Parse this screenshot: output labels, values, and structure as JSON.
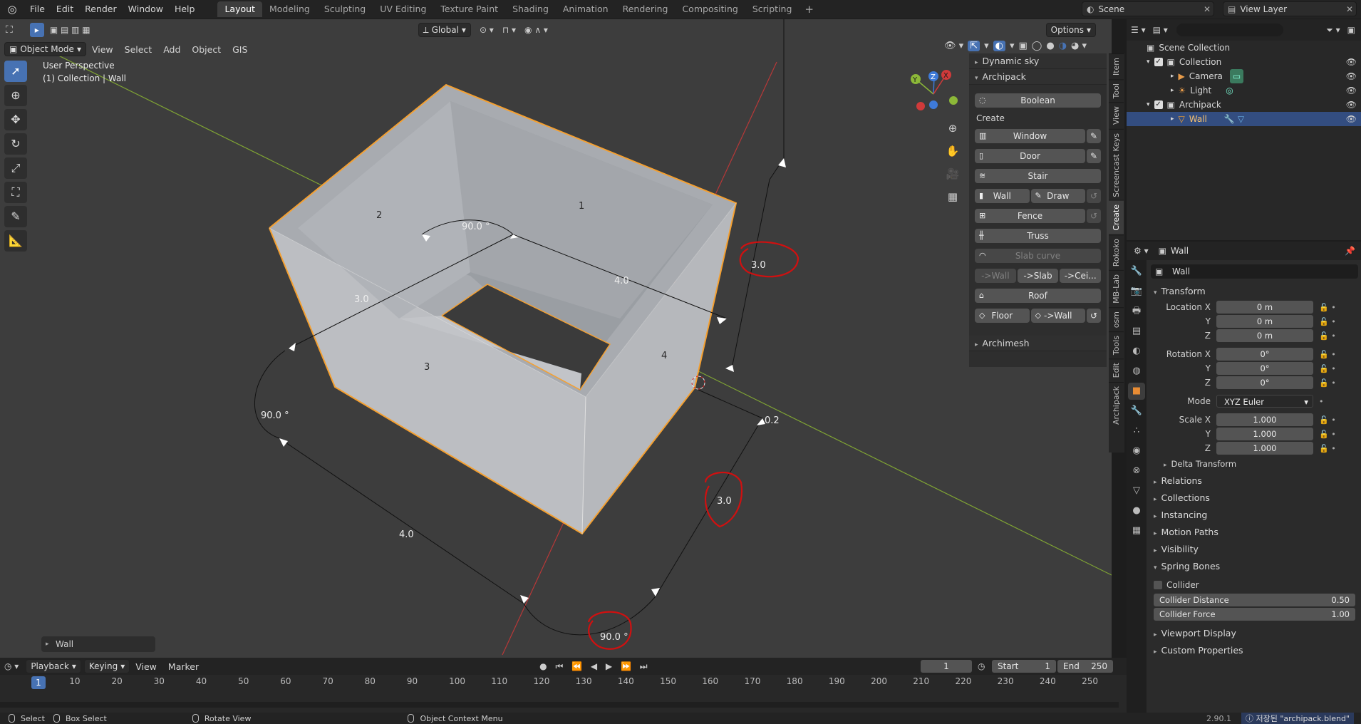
{
  "menu": [
    "File",
    "Edit",
    "Render",
    "Window",
    "Help"
  ],
  "workspaces": [
    "Layout",
    "Modeling",
    "Sculpting",
    "UV Editing",
    "Texture Paint",
    "Shading",
    "Animation",
    "Rendering",
    "Compositing",
    "Scripting"
  ],
  "active_workspace": "Layout",
  "scene_name": "Scene",
  "view_layer": "View Layer",
  "viewport": {
    "mode": "Object Mode",
    "menus": [
      "View",
      "Select",
      "Add",
      "Object",
      "GIS"
    ],
    "orientation": "Global",
    "options": "Options",
    "perspective": "User Perspective",
    "collection_info": "(1) Collection | Wall",
    "last_operator": "Wall",
    "face_labels": [
      "1",
      "2",
      "3",
      "4"
    ],
    "dimensions": [
      "3.0",
      "4.0",
      "3.0",
      "4.0",
      "3.0",
      "90.0 °",
      "90.0 °",
      "90.0 °",
      "3.0",
      "0.2"
    ],
    "gizmo_axes": [
      "Y",
      "Z",
      "X"
    ]
  },
  "npanel": {
    "sections": [
      "Dynamic sky",
      "Archipack",
      "Archimesh"
    ],
    "boolean": "Boolean",
    "create_label": "Create",
    "window": "Window",
    "door": "Door",
    "stair": "Stair",
    "wall": "Wall",
    "draw": "Draw",
    "fence": "Fence",
    "truss": "Truss",
    "slab_curve": "Slab curve",
    "to_wall": "->Wall",
    "to_slab": "->Slab",
    "to_ceil": "->Cei...",
    "roof": "Roof",
    "floor": "Floor",
    "floor_to_wall": "->Wall",
    "side_tabs": [
      "Item",
      "Tool",
      "View",
      "Screencast Keys",
      "Create",
      "Rokoko",
      "MB-Lab",
      "osm",
      "Tools",
      "Edit",
      "Archipack"
    ]
  },
  "outliner": {
    "search_placeholder": "",
    "root": "Scene Collection",
    "items": [
      "Collection",
      "Camera",
      "Light",
      "Archipack",
      "Wall"
    ]
  },
  "properties": {
    "object_name": "Wall",
    "data_name": "Wall",
    "transform": "Transform",
    "location_x_label": "Location X",
    "y_label": "Y",
    "z_label": "Z",
    "location": [
      "0 m",
      "0 m",
      "0 m"
    ],
    "rotation_x_label": "Rotation X",
    "rotation": [
      "0°",
      "0°",
      "0°"
    ],
    "mode_label": "Mode",
    "mode": "XYZ Euler",
    "scale_x_label": "Scale X",
    "scale": [
      "1.000",
      "1.000",
      "1.000"
    ],
    "delta_transform": "Delta Transform",
    "sections": [
      "Relations",
      "Collections",
      "Instancing",
      "Motion Paths",
      "Visibility"
    ],
    "spring_bones": "Spring Bones",
    "collider": "Collider",
    "collider_distance_label": "Collider Distance",
    "collider_distance": "0.50",
    "collider_force_label": "Collider Force",
    "collider_force": "1.00",
    "viewport_display": "Viewport Display",
    "custom_properties": "Custom Properties"
  },
  "timeline": {
    "menus": [
      "Playback",
      "Keying",
      "View",
      "Marker"
    ],
    "current_frame": "1",
    "start_label": "Start",
    "start": "1",
    "end_label": "End",
    "end": "250",
    "ruler": [
      "1",
      "10",
      "20",
      "30",
      "40",
      "50",
      "60",
      "70",
      "80",
      "90",
      "100",
      "110",
      "120",
      "130",
      "140",
      "150",
      "160",
      "170",
      "180",
      "190",
      "200",
      "210",
      "220",
      "230",
      "240",
      "250"
    ]
  },
  "status": {
    "select": "Select",
    "box_select": "Box Select",
    "rotate_view": "Rotate View",
    "context_menu": "Object Context Menu",
    "version": "2.90.1",
    "saved": "저장된 \"archipack.blend\""
  },
  "colors": {
    "accent": "#4772b3",
    "selection_orange": "#f5a030",
    "annotation_red": "#d01010"
  }
}
